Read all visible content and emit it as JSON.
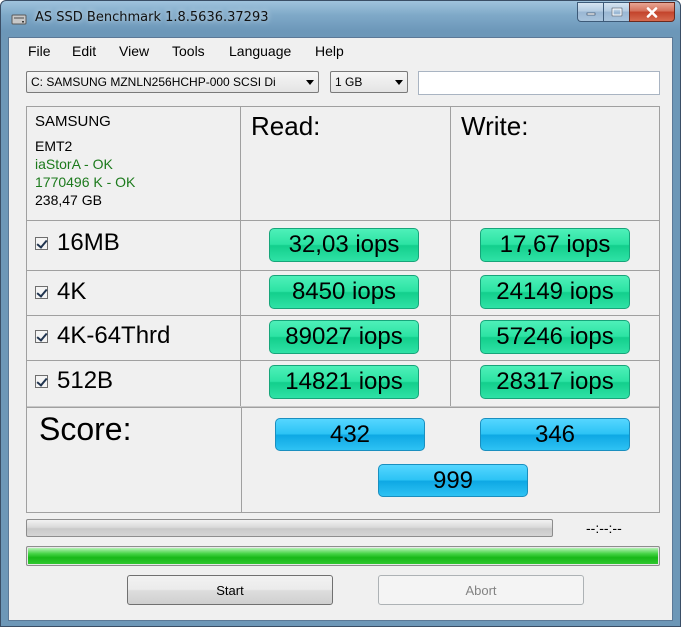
{
  "window": {
    "title": "AS SSD Benchmark 1.8.5636.37293"
  },
  "menu": [
    "File",
    "Edit",
    "View",
    "Tools",
    "Language",
    "Help"
  ],
  "toolbar": {
    "drive": "C: SAMSUNG MZNLN256HCHP-000 SCSI Di",
    "size": "1 GB",
    "extra_field": ""
  },
  "drive_info": {
    "name": "SAMSUNG",
    "firmware": "EMT2",
    "driver": "iaStorA - OK",
    "alignment": "1770496 K - OK",
    "capacity": "238,47 GB",
    "ok_color": "#1c7a1c"
  },
  "headers": {
    "read": "Read:",
    "write": "Write:"
  },
  "rows": [
    {
      "label": "16MB",
      "read": "32,03 iops",
      "write": "17,67 iops"
    },
    {
      "label": "4K",
      "read": "8450 iops",
      "write": "24149 iops"
    },
    {
      "label": "4K-64Thrd",
      "read": "89027 iops",
      "write": "57246 iops"
    },
    {
      "label": "512B",
      "read": "14821 iops",
      "write": "28317 iops"
    }
  ],
  "score": {
    "label": "Score:",
    "read": "432",
    "write": "346",
    "total": "999"
  },
  "progress": {
    "fraction": 0.0,
    "time": "--:--:--",
    "overall_fraction": 1.0
  },
  "buttons": {
    "start": "Start",
    "abort": "Abort"
  },
  "colors": {
    "result_green": "#2ce3a3",
    "score_blue": "#2cc3f5",
    "progress_green": "#18b818"
  }
}
